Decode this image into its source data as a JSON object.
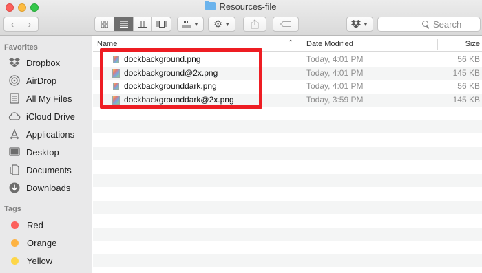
{
  "window": {
    "title": "Resources-file"
  },
  "toolbar": {
    "search_placeholder": "Search"
  },
  "sidebar": {
    "favorites_heading": "Favorites",
    "favorites": [
      {
        "label": "Dropbox",
        "icon": "dropbox-icon"
      },
      {
        "label": "AirDrop",
        "icon": "airdrop-icon"
      },
      {
        "label": "All My Files",
        "icon": "all-files-icon"
      },
      {
        "label": "iCloud Drive",
        "icon": "cloud-icon"
      },
      {
        "label": "Applications",
        "icon": "applications-icon"
      },
      {
        "label": "Desktop",
        "icon": "desktop-icon"
      },
      {
        "label": "Documents",
        "icon": "documents-icon"
      },
      {
        "label": "Downloads",
        "icon": "downloads-icon"
      }
    ],
    "tags_heading": "Tags",
    "tags": [
      {
        "label": "Red",
        "color": "#fc605c"
      },
      {
        "label": "Orange",
        "color": "#fdb343"
      },
      {
        "label": "Yellow",
        "color": "#fdd648"
      }
    ]
  },
  "columns": {
    "name": "Name",
    "date": "Date Modified",
    "size": "Size"
  },
  "files": [
    {
      "name": "dockbackground.png",
      "date": "Today, 4:01 PM",
      "size": "56 KB"
    },
    {
      "name": "dockbackground@2x.png",
      "date": "Today, 4:01 PM",
      "size": "145 KB"
    },
    {
      "name": "dockbackgrounddark.png",
      "date": "Today, 4:01 PM",
      "size": "56 KB"
    },
    {
      "name": "dockbackgrounddark@2x.png",
      "date": "Today, 3:59 PM",
      "size": "145 KB"
    }
  ],
  "highlight_color": "#ee1d23"
}
